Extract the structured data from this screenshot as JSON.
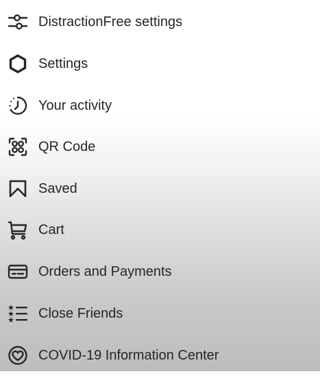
{
  "menu": {
    "items": [
      {
        "label": "DistractionFree settings",
        "icon": "sliders-icon"
      },
      {
        "label": "Settings",
        "icon": "gear-icon"
      },
      {
        "label": "Your activity",
        "icon": "activity-icon"
      },
      {
        "label": "QR Code",
        "icon": "qr-code-icon"
      },
      {
        "label": "Saved",
        "icon": "bookmark-icon"
      },
      {
        "label": "Cart",
        "icon": "cart-icon"
      },
      {
        "label": "Orders and Payments",
        "icon": "credit-card-icon"
      },
      {
        "label": "Close Friends",
        "icon": "close-friends-list-icon"
      },
      {
        "label": "COVID-19 Information Center",
        "icon": "covid-heart-icon"
      }
    ]
  },
  "colors": {
    "text": "#262626",
    "icon": "#262626"
  }
}
